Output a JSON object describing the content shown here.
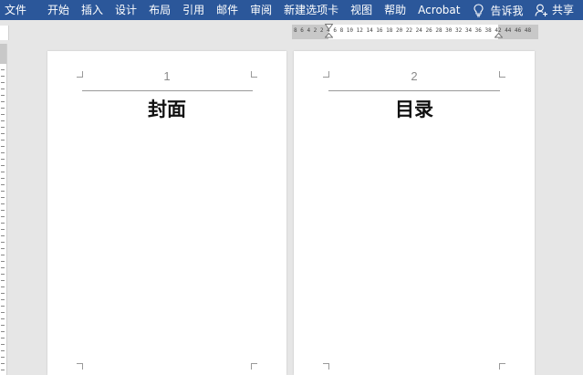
{
  "menu": {
    "items": [
      "文件",
      "开始",
      "插入",
      "设计",
      "布局",
      "引用",
      "邮件",
      "审阅",
      "新建选项卡",
      "视图",
      "帮助",
      "Acrobat"
    ],
    "tell_me": "告诉我",
    "share": "共享"
  },
  "ruler": {
    "numbers": "8 6 4 2    2  4  6  8 10 12 14 16 18 20 22 24 26 28 30 32 34 36 38    42 44 46 48"
  },
  "pages": [
    {
      "header_number": "1",
      "title": "封面"
    },
    {
      "header_number": "2",
      "title": "目录"
    }
  ],
  "colors": {
    "ribbon": "#2b579a",
    "workspace": "#e6e6e6",
    "page": "#ffffff"
  }
}
